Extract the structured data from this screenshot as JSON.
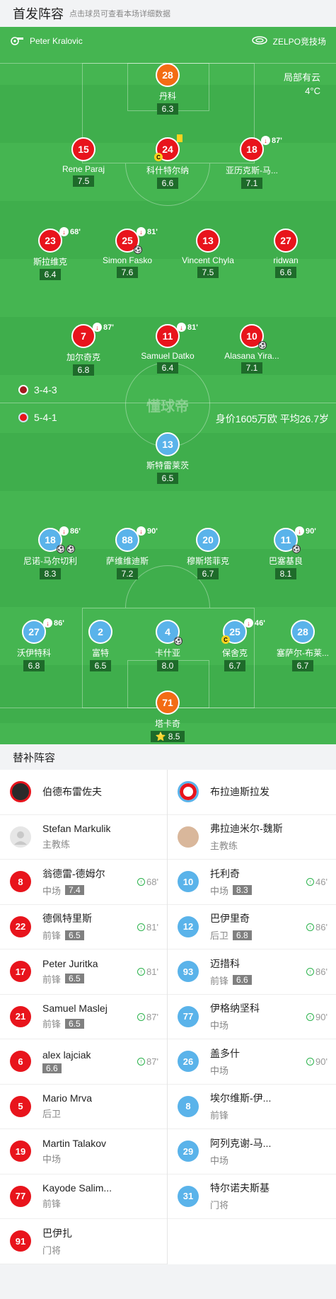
{
  "header": {
    "title": "首发阵容",
    "subtitle": "点击球员可查看本场详细数据"
  },
  "pitch": {
    "referee": "Peter Kralovic",
    "stadium": "ZELPO竞技场",
    "weather": "局部有云",
    "temperature": "4°C",
    "home_formation": "3-4-3",
    "away_formation": "5-4-1",
    "away_value": "身价1605万欧 平均26.7岁",
    "watermark": "懂球帝"
  },
  "home_players": [
    {
      "id": "h1",
      "num": "28",
      "name": "丹科",
      "rating": "6.3"
    },
    {
      "id": "h2",
      "num": "15",
      "name": "Rene Paraj",
      "rating": "7.5"
    },
    {
      "id": "h3",
      "num": "24",
      "name": "科什特尔纳",
      "rating": "6.6"
    },
    {
      "id": "h4",
      "num": "18",
      "name": "亚历克斯-马...",
      "rating": "7.1",
      "sub": "87'"
    },
    {
      "id": "h5",
      "num": "23",
      "name": "斯拉维克",
      "rating": "6.4",
      "sub": "68'"
    },
    {
      "id": "h6",
      "num": "25",
      "name": "Simon Fasko",
      "rating": "7.6",
      "sub": "81'"
    },
    {
      "id": "h7",
      "num": "13",
      "name": "Vincent Chyla",
      "rating": "7.5"
    },
    {
      "id": "h8",
      "num": "27",
      "name": "ridwan",
      "rating": "6.6"
    },
    {
      "id": "h9",
      "num": "7",
      "name": "加尔奇克",
      "rating": "6.8",
      "sub": "87'"
    },
    {
      "id": "h10",
      "num": "11",
      "name": "Samuel Datko",
      "rating": "6.4",
      "sub": "81'"
    },
    {
      "id": "h11",
      "num": "10",
      "name": "Alasana Yira...",
      "rating": "7.1"
    }
  ],
  "away_players": [
    {
      "id": "a1",
      "num": "13",
      "name": "斯特雷莱茨",
      "rating": "6.5"
    },
    {
      "id": "a2",
      "num": "18",
      "name": "尼诺-马尔切利",
      "rating": "8.3",
      "sub": "86'"
    },
    {
      "id": "a3",
      "num": "88",
      "name": "萨维维迪斯",
      "rating": "7.2",
      "sub": "90'"
    },
    {
      "id": "a4",
      "num": "20",
      "name": "穆斯塔菲克",
      "rating": "6.7"
    },
    {
      "id": "a5",
      "num": "11",
      "name": "巴塞基良",
      "rating": "8.1",
      "sub": "90'"
    },
    {
      "id": "a6",
      "num": "27",
      "name": "沃伊特科",
      "rating": "6.8",
      "sub": "86'"
    },
    {
      "id": "a7",
      "num": "2",
      "name": "富特",
      "rating": "6.5"
    },
    {
      "id": "a8",
      "num": "4",
      "name": "卡什亚",
      "rating": "8.0"
    },
    {
      "id": "a9",
      "num": "25",
      "name": "保舍克",
      "rating": "6.7",
      "sub": "46'"
    },
    {
      "id": "a10",
      "num": "28",
      "name": "塞萨尔-布莱...",
      "rating": "6.7"
    },
    {
      "id": "a11",
      "num": "71",
      "name": "塔卡奇",
      "rating": "8.5"
    }
  ],
  "subs": {
    "title": "替补阵容",
    "home": {
      "team": "伯德布雷佐夫",
      "coach": {
        "name": "Stefan Markulik",
        "role": "主教练"
      },
      "players": [
        {
          "num": "8",
          "name": "翁德雷-德姆尔",
          "pos": "中场",
          "rating": "7.4",
          "time": "68'"
        },
        {
          "num": "22",
          "name": "德佩特里斯",
          "pos": "前锋",
          "rating": "6.5",
          "time": "81'"
        },
        {
          "num": "17",
          "name": "Peter Juritka",
          "pos": "前锋",
          "rating": "6.5",
          "time": "81'"
        },
        {
          "num": "21",
          "name": "Samuel Maslej",
          "pos": "前锋",
          "rating": "6.5",
          "time": "87'"
        },
        {
          "num": "6",
          "name": "alex lajciak",
          "pos": "",
          "rating": "6.6",
          "time": "87'"
        },
        {
          "num": "5",
          "name": "Mario Mrva",
          "pos": "后卫",
          "rating": "",
          "time": ""
        },
        {
          "num": "19",
          "name": "Martin Talakov",
          "pos": "中场",
          "rating": "",
          "time": ""
        },
        {
          "num": "77",
          "name": "Kayode Salim...",
          "pos": "前锋",
          "rating": "",
          "time": ""
        },
        {
          "num": "91",
          "name": "巴伊扎",
          "pos": "门将",
          "rating": "",
          "time": ""
        }
      ]
    },
    "away": {
      "team": "布拉迪斯拉发",
      "coach": {
        "name": "弗拉迪米尔-魏斯",
        "role": "主教练"
      },
      "players": [
        {
          "num": "10",
          "name": "托利奇",
          "pos": "中场",
          "rating": "8.3",
          "time": "46'"
        },
        {
          "num": "12",
          "name": "巴伊里奇",
          "pos": "后卫",
          "rating": "6.8",
          "time": "86'"
        },
        {
          "num": "93",
          "name": "迈措科",
          "pos": "前锋",
          "rating": "6.6",
          "time": "86'"
        },
        {
          "num": "77",
          "name": "伊格纳坚科",
          "pos": "中场",
          "rating": "",
          "time": "90'"
        },
        {
          "num": "26",
          "name": "盖多什",
          "pos": "中场",
          "rating": "",
          "time": "90'"
        },
        {
          "num": "8",
          "name": "埃尔维斯-伊...",
          "pos": "前锋",
          "rating": "",
          "time": ""
        },
        {
          "num": "29",
          "name": "阿列克谢-马...",
          "pos": "中场",
          "rating": "",
          "time": ""
        },
        {
          "num": "31",
          "name": "特尔诺夫斯基",
          "pos": "门将",
          "rating": "",
          "time": ""
        }
      ]
    }
  }
}
